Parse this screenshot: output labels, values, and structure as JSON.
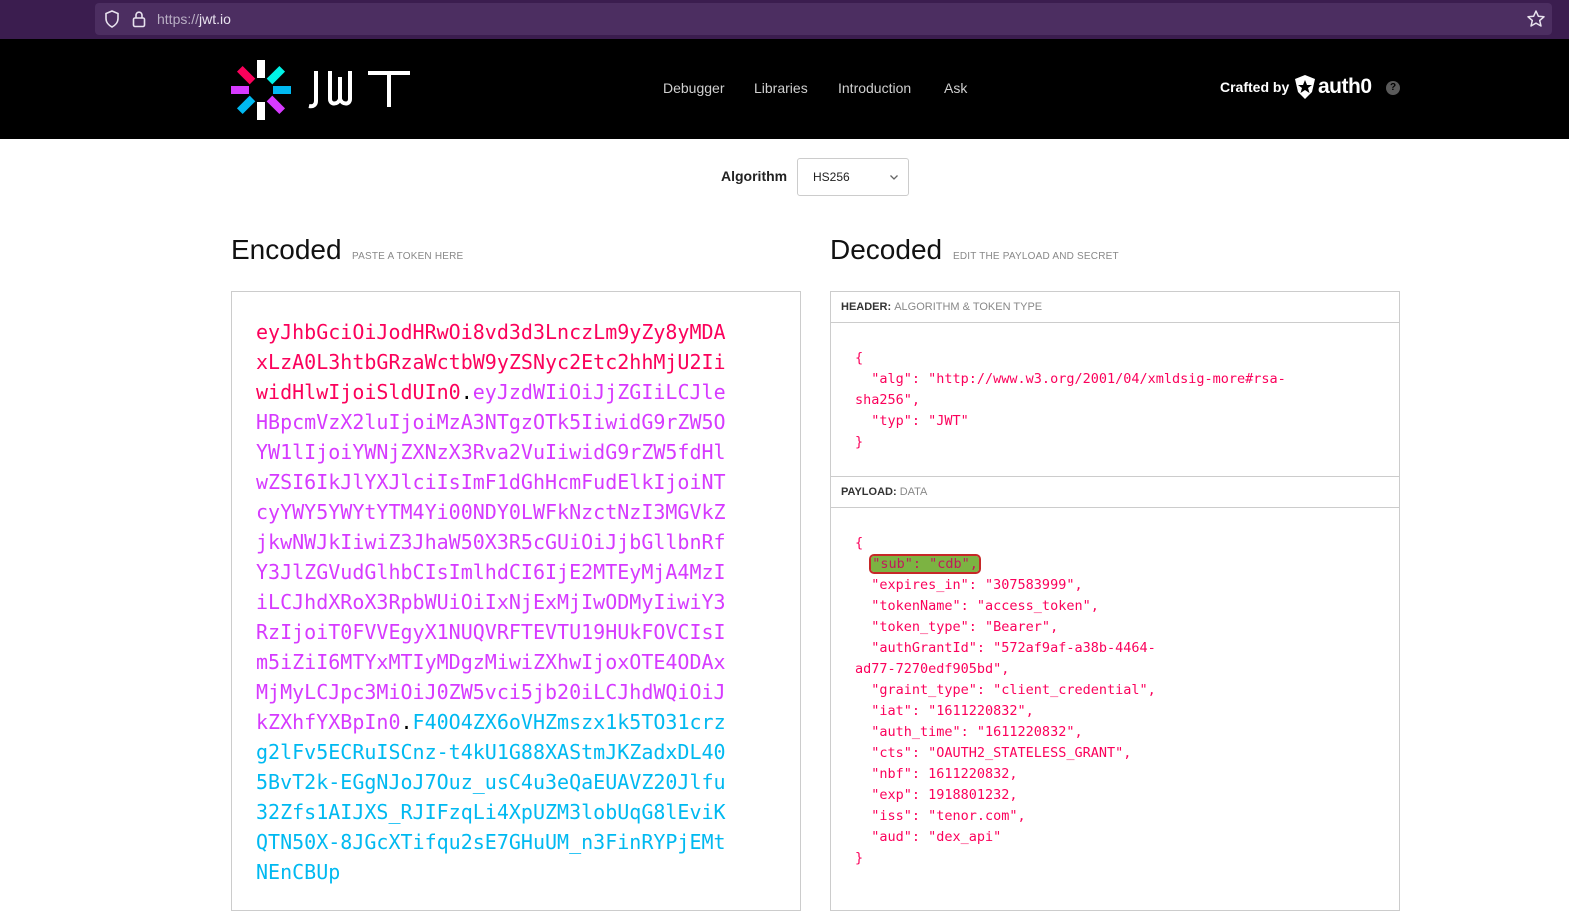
{
  "browser": {
    "url_scheme": "https://",
    "url_host": "jwt.io"
  },
  "header": {
    "logo_text": "JWT",
    "nav": [
      "Debugger",
      "Libraries",
      "Introduction",
      "Ask"
    ],
    "crafted_by": "Crafted by",
    "brand": "auth0"
  },
  "algorithm": {
    "label": "Algorithm",
    "selected": "HS256"
  },
  "encoded": {
    "title": "Encoded",
    "subtitle": "PASTE A TOKEN HERE",
    "token_header": "eyJhbGciOiJodHRwOi8vd3d3LnczLm9yZy8yMDAxLzA0L3htbGRzaWctbW9yZSNyc2Etc2hhMjU2IiwidHlwIjoiSldUIn0",
    "token_payload": "eyJzdWIiOiJjZGIiLCJleHBpcmVzX2luIjoiMzA3NTgzOTk5IiwidG9rZW5OYW1lIjoiYWNjZXNzX3Rva2VuIiwidG9rZW5fdHlwZSI6IkJlYXJlciIsImF1dGhHcmFudElkIjoiNTcyYWY5YWYtYTM4Yi00NDY0LWFkNzctNzI3MGVkZjkwNWJkIiwiZ3JhaW50X3R5cGUiOiJjbGllbnRfY3JlZGVudGlhbCIsImlhdCI6IjE2MTEyMjA4MzIiLCJhdXRoX3RpbWUiOiIxNjExMjIwODMyIiwiY3RzIjoiT0FVVEgyX1NUQVRFTEVTU19HUkFOVCIsIm5iZiI6MTYxMTIyMDgzMiwiZXhwIjoxOTE4ODAxMjMyLCJpc3MiOiJ0ZW5vci5jb20iLCJhdWQiOiJkZXhfYXBpIn0",
    "token_signature": "F40O4ZX6oVHZmszx1k5TO31crzg2lFv5ECRuISCnz-t4kU1G88XAStmJKZadxDL405BvT2k-EGgNJoJ7Ouz_usC4u3eQaEUAVZ20Jlfu32Zfs1AIJXS_RJIFzqLi4XpUZM3lobUqG8lEviKQTN50X-8JGcXTifqu2sE7GHuUM_n3FinRYPjEMtNEnCBUp",
    "dot": "."
  },
  "decoded": {
    "title": "Decoded",
    "subtitle": "EDIT THE PAYLOAD AND SECRET",
    "header_label": "HEADER:",
    "header_label2": "ALGORITHM & TOKEN TYPE",
    "payload_label": "PAYLOAD:",
    "payload_label2": "DATA",
    "header_lines": {
      "l1": "{",
      "l2": "  \"alg\": \"http://www.w3.org/2001/04/xmldsig-more#rsa-",
      "l3": "sha256\",",
      "l4": "  \"typ\": \"JWT\"",
      "l5": "}"
    },
    "payload_lines": {
      "open": "{",
      "sub_highlight": "\"sub\": \"cdb\",",
      "l_expires": "  \"expires_in\": \"307583999\",",
      "l_tokenName": "  \"tokenName\": \"access_token\",",
      "l_token_type": "  \"token_type\": \"Bearer\",",
      "l_authGrant1": "  \"authGrantId\": \"572af9af-a38b-4464-",
      "l_authGrant2": "ad77-7270edf905bd\",",
      "l_graint": "  \"graint_type\": \"client_credential\",",
      "l_iat": "  \"iat\": \"1611220832\",",
      "l_auth_time": "  \"auth_time\": \"1611220832\",",
      "l_cts": "  \"cts\": \"OAUTH2_STATELESS_GRANT\",",
      "l_nbf": "  \"nbf\": 1611220832,",
      "l_exp": "  \"exp\": 1918801232,",
      "l_iss": "  \"iss\": \"tenor.com\",",
      "l_aud": "  \"aud\": \"dex_api\"",
      "close": "}"
    }
  },
  "colors": {
    "token_header": "#fb015b",
    "token_payload": "#d63aff",
    "token_signature": "#00b9f1",
    "highlight_fill": "#7cb342",
    "highlight_border": "#c62828"
  }
}
